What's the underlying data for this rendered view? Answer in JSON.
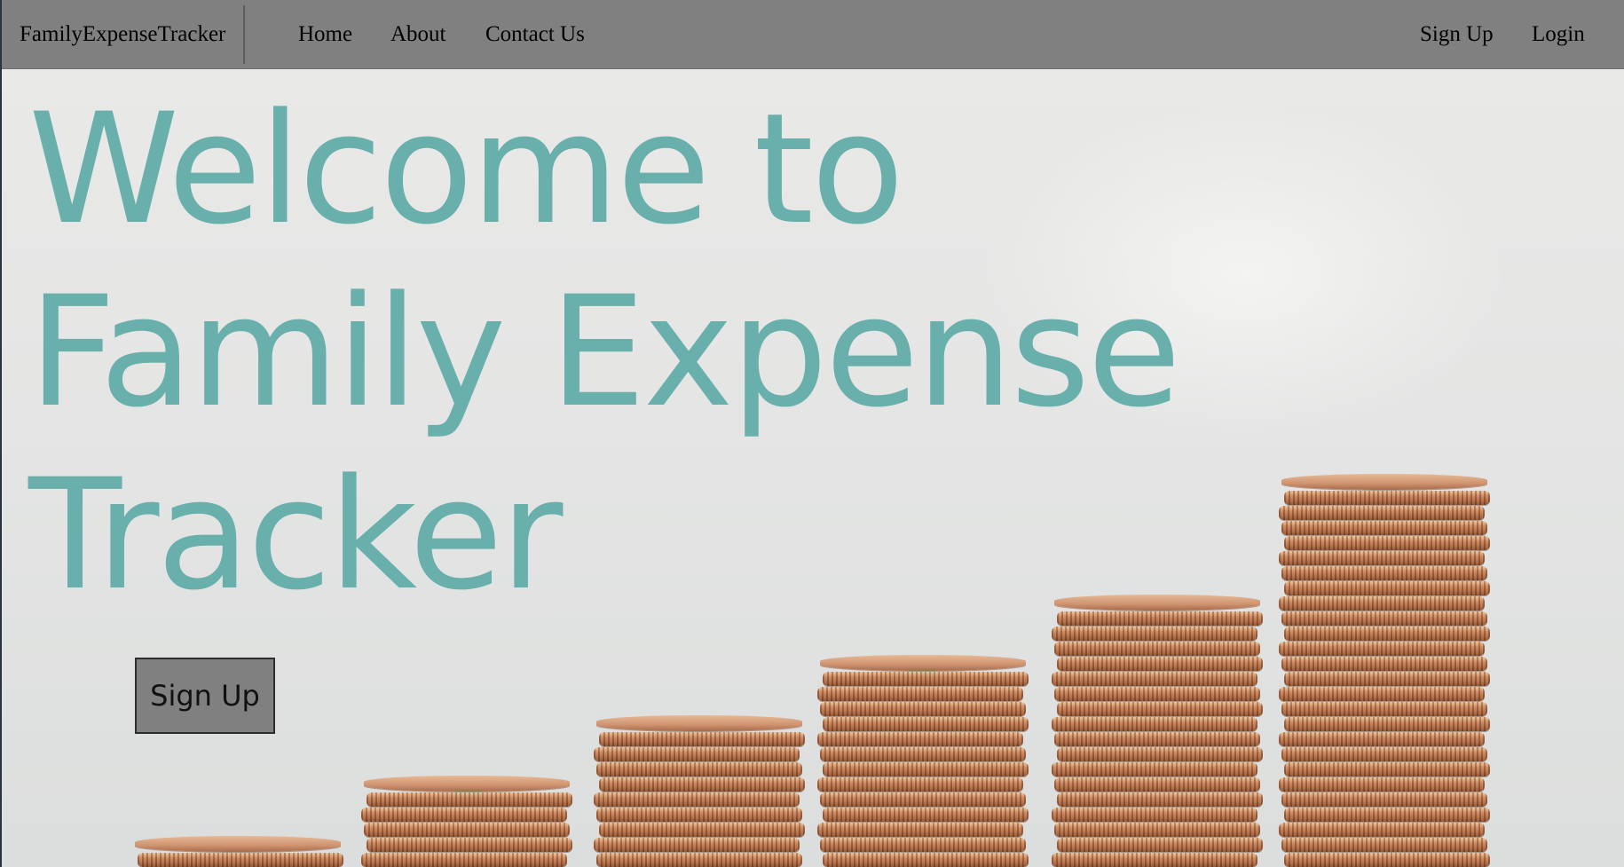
{
  "navbar": {
    "brand": "FamilyExpenseTracker",
    "links": {
      "home": "Home",
      "about": "About",
      "contact": "Contact Us"
    },
    "auth": {
      "signup": "Sign Up",
      "login": "Login"
    }
  },
  "hero": {
    "title_lines": [
      "Welcome to",
      "Family Expense",
      "Tracker"
    ],
    "signup_button": "Sign Up",
    "background_image": "stacks-of-copper-coins",
    "colors": {
      "title": "#69b0ad",
      "navbar": "#808080",
      "button": "#808080"
    }
  },
  "coin_stacks": [
    {
      "coins": 2
    },
    {
      "coins": 6
    },
    {
      "coins": 10
    },
    {
      "coins": 14
    },
    {
      "coins": 18
    },
    {
      "coins": 26
    }
  ]
}
